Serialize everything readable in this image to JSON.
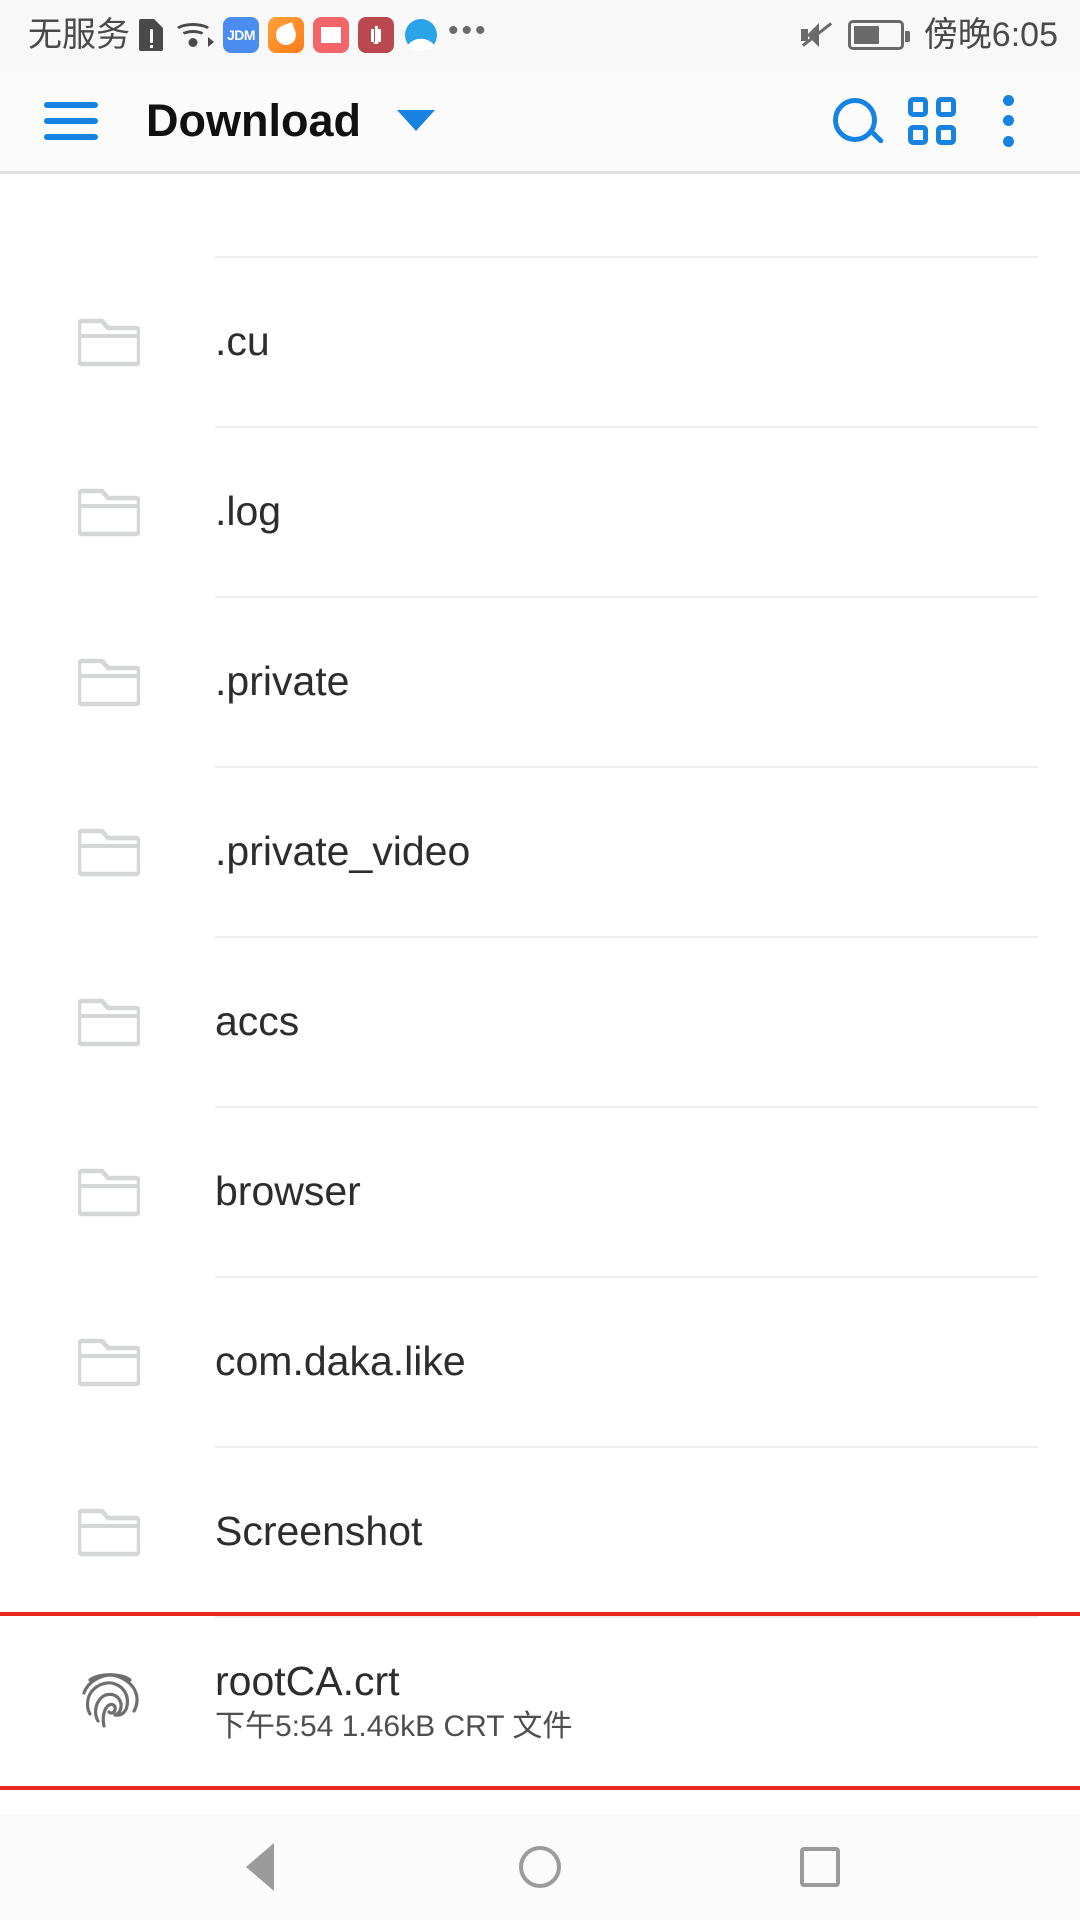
{
  "status_bar": {
    "carrier": "无服务",
    "clock": "傍晚6:05",
    "icons": [
      "sim-alert-icon",
      "wifi-icon",
      "app-jdm-icon",
      "app-uc-browser-icon",
      "app-reader-icon",
      "app-huawei-icon",
      "app-cloud-icon",
      "more-notifications-icon"
    ],
    "jdm_label": "JDM",
    "more_glyph": "•••",
    "mute_icon": "mute-icon",
    "battery_icon": "battery-icon",
    "battery_level_percent": 58
  },
  "toolbar": {
    "menu_icon": "hamburger-menu-icon",
    "title": "Download",
    "dropdown_icon": "chevron-down-icon",
    "search_icon": "search-icon",
    "grid_view_icon": "grid-view-icon",
    "overflow_icon": "more-vertical-icon",
    "accent_color": "#1683e0"
  },
  "file_list": {
    "items": [
      {
        "name": ".cu",
        "icon": "folder-icon",
        "subtitle": ""
      },
      {
        "name": ".log",
        "icon": "folder-icon",
        "subtitle": ""
      },
      {
        "name": ".private",
        "icon": "folder-icon",
        "subtitle": ""
      },
      {
        "name": ".private_video",
        "icon": "folder-icon",
        "subtitle": ""
      },
      {
        "name": "accs",
        "icon": "folder-icon",
        "subtitle": ""
      },
      {
        "name": "browser",
        "icon": "folder-icon",
        "subtitle": ""
      },
      {
        "name": "com.daka.like",
        "icon": "folder-icon",
        "subtitle": ""
      },
      {
        "name": "Screenshot",
        "icon": "folder-icon",
        "subtitle": ""
      },
      {
        "name": "rootCA.crt",
        "icon": "fingerprint-icon",
        "subtitle": "下午5:54 1.46kB CRT 文件",
        "highlighted": true
      }
    ],
    "highlight_color": "#e8281f"
  },
  "nav_bar": {
    "back_icon": "back-triangle-icon",
    "home_icon": "home-circle-icon",
    "recents_icon": "recents-square-icon"
  }
}
